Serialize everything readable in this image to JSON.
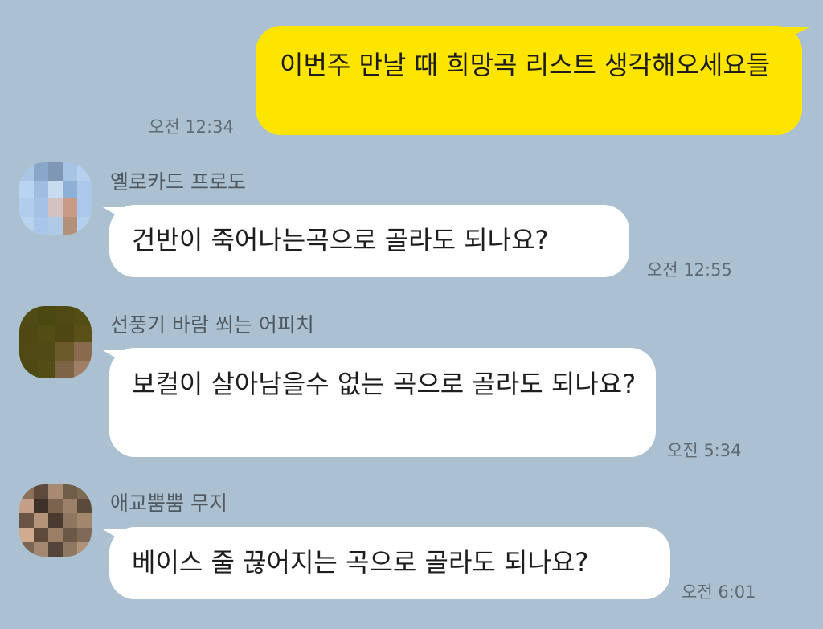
{
  "messages": [
    {
      "direction": "outgoing",
      "text": "이번주 만날 때 희망곡 리스트 생각해오세요들",
      "time": "오전 12:34"
    },
    {
      "direction": "incoming",
      "sender": "옐로카드 프로도",
      "text": "건반이 죽어나는곡으로 골라도 되나요?",
      "time": "오전 12:55"
    },
    {
      "direction": "incoming",
      "sender": "선풍기 바람 쐬는 어피치",
      "text": "보컬이 살아남을수 없는 곡으로 골라도 되나요?",
      "time": "오전 5:34"
    },
    {
      "direction": "incoming",
      "sender": "애교뿜뿜 무지",
      "text": "베이스 줄 끊어지는 곡으로 골라도 되나요?",
      "time": "오전 6:01"
    }
  ],
  "avatar_colors": {
    "frodo": "#9cc4e8",
    "apeach": "#4f4a14",
    "muzi": "#6e5a48"
  }
}
